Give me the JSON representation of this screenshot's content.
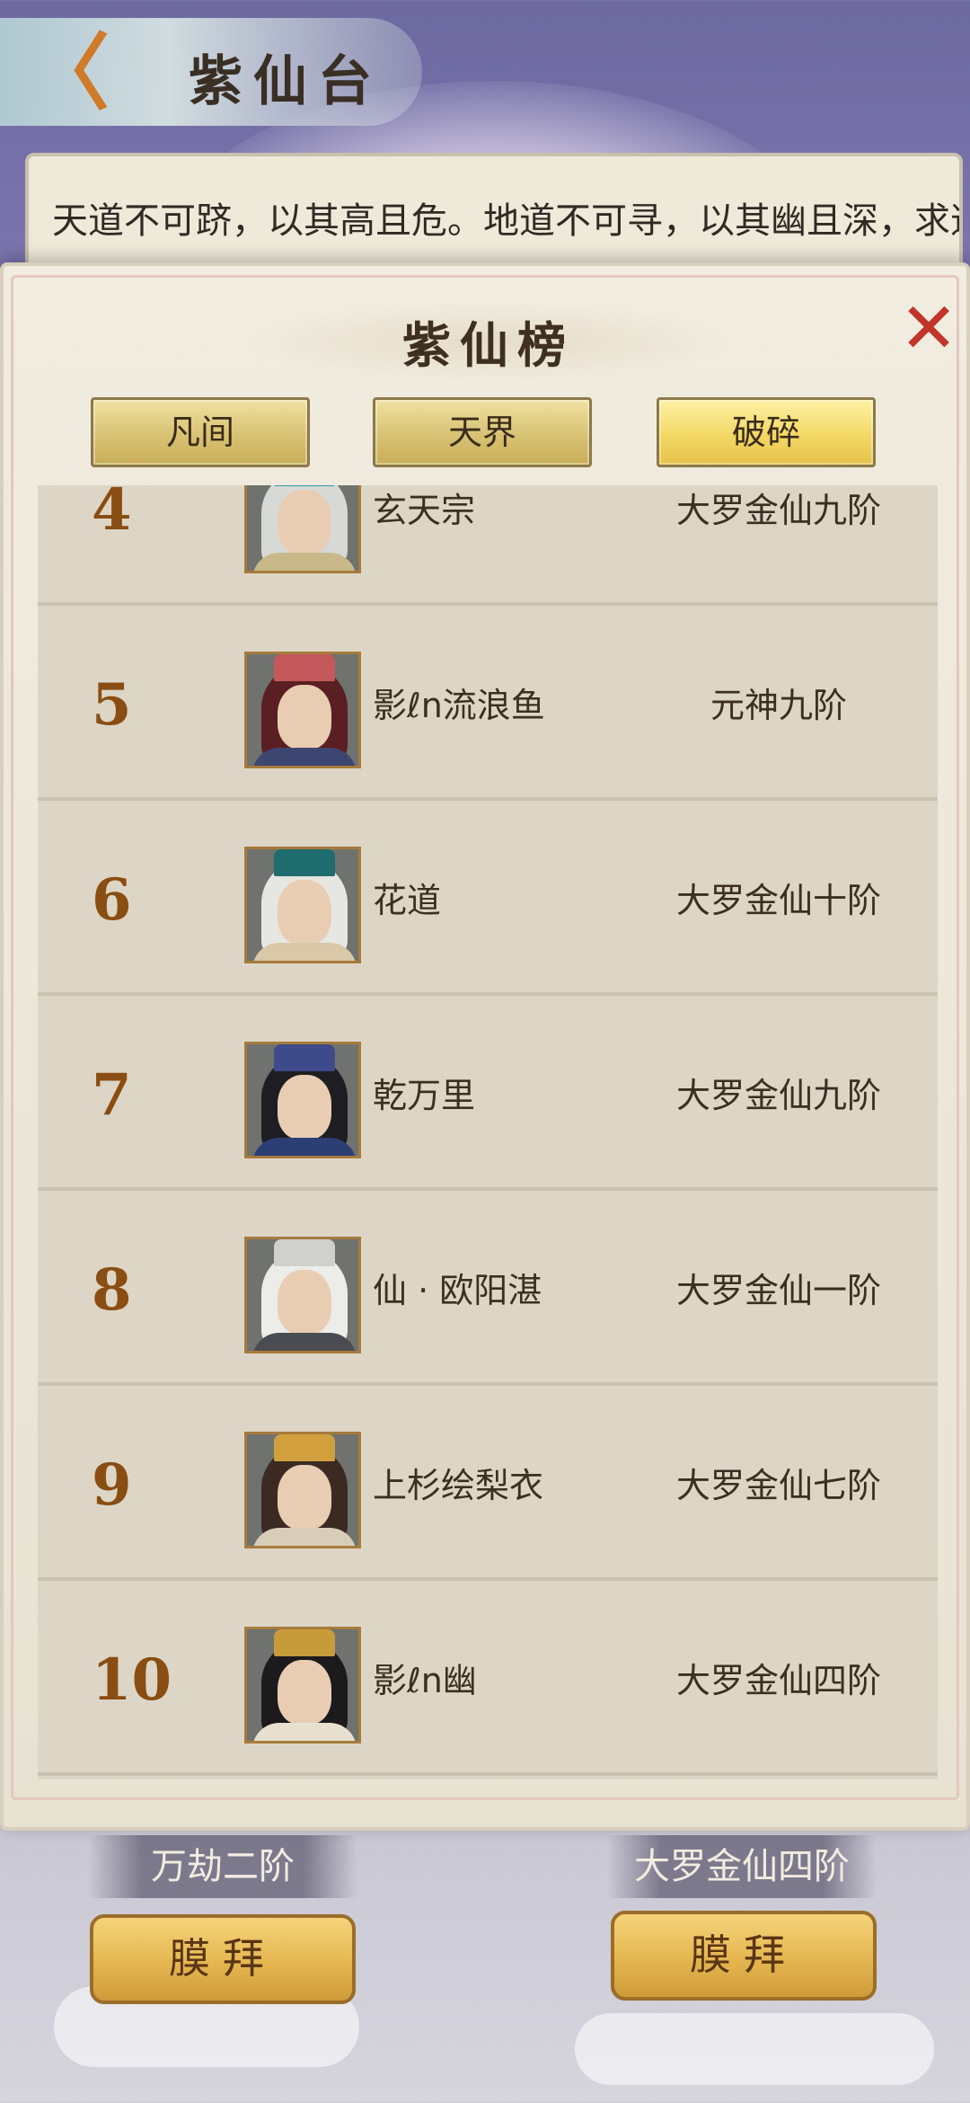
{
  "header": {
    "back_icon": "back-arrow-icon",
    "back_glyph": "〈",
    "title": "紫仙台"
  },
  "description": {
    "text": "天道不可跻，以其高且危。地道不可寻，以其幽且深，求道者无数，如果道非有求，退拉耀之，相毒"
  },
  "modal": {
    "title": "紫仙榜",
    "close_glyph": "✕",
    "tabs": [
      {
        "label": "凡间",
        "active": false
      },
      {
        "label": "天界",
        "active": false
      },
      {
        "label": "破碎",
        "active": true
      }
    ],
    "rows": [
      {
        "rank": "4",
        "name": "玄天宗",
        "realm": "大罗金仙九阶"
      },
      {
        "rank": "5",
        "name": "影ℓn流浪鱼",
        "realm": "元神九阶"
      },
      {
        "rank": "6",
        "name": "花道",
        "realm": "大罗金仙十阶"
      },
      {
        "rank": "7",
        "name": "乾万里",
        "realm": "大罗金仙九阶"
      },
      {
        "rank": "8",
        "name": "仙 · 欧阳湛",
        "realm": "大罗金仙一阶"
      },
      {
        "rank": "9",
        "name": "上杉绘梨衣",
        "realm": "大罗金仙七阶"
      },
      {
        "rank": "10",
        "name": "影ℓn幽",
        "realm": "大罗金仙四阶"
      }
    ]
  },
  "bottom": {
    "left": {
      "realm": "万劫二阶",
      "button": "膜拜"
    },
    "right": {
      "realm": "大罗金仙四阶",
      "button": "膜拜"
    }
  },
  "colors": {
    "rank_text": "#8a4d12",
    "tab_active": "#f3d865",
    "close": "#c2352a"
  }
}
